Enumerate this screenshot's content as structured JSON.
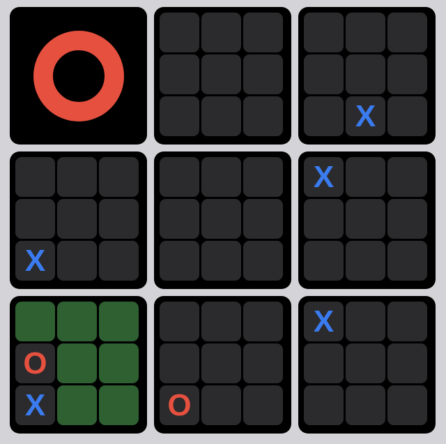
{
  "colors": {
    "background": "#d4d4d8",
    "board_frame": "#000000",
    "cell_empty": "#2b2b2d",
    "cell_highlight": "#2e6032",
    "x_mark": "#3a7bf0",
    "o_mark": "#e5503f"
  },
  "boards": [
    {
      "winner": "O",
      "cells": [
        "",
        "",
        "",
        "",
        "",
        "",
        "",
        "",
        ""
      ],
      "highlight": []
    },
    {
      "winner": "",
      "cells": [
        "",
        "",
        "",
        "",
        "",
        "",
        "",
        "",
        ""
      ],
      "highlight": []
    },
    {
      "winner": "",
      "cells": [
        "",
        "",
        "",
        "",
        "",
        "",
        "",
        "X",
        ""
      ],
      "highlight": []
    },
    {
      "winner": "",
      "cells": [
        "",
        "",
        "",
        "",
        "",
        "",
        "X",
        "",
        ""
      ],
      "highlight": []
    },
    {
      "winner": "",
      "cells": [
        "",
        "",
        "",
        "",
        "",
        "",
        "",
        "",
        ""
      ],
      "highlight": []
    },
    {
      "winner": "",
      "cells": [
        "X",
        "",
        "",
        "",
        "",
        "",
        "",
        "",
        ""
      ],
      "highlight": []
    },
    {
      "winner": "",
      "cells": [
        "",
        "",
        "",
        "O",
        "",
        "",
        "X",
        "",
        ""
      ],
      "highlight": [
        0,
        1,
        2,
        4,
        5,
        7,
        8
      ]
    },
    {
      "winner": "",
      "cells": [
        "",
        "",
        "",
        "",
        "",
        "",
        "O",
        "",
        ""
      ],
      "highlight": []
    },
    {
      "winner": "",
      "cells": [
        "X",
        "",
        "",
        "",
        "",
        "",
        "",
        "",
        ""
      ],
      "highlight": []
    }
  ]
}
